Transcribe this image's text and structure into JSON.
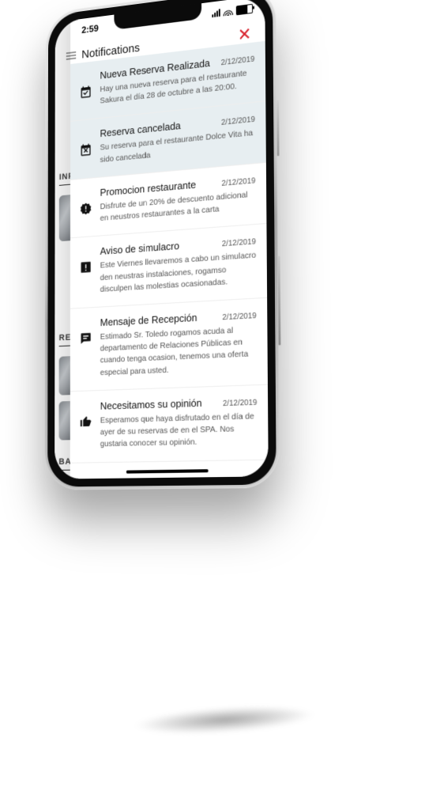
{
  "status": {
    "time": "2:59"
  },
  "header": {
    "title": "Notifications",
    "close_glyph": "✕"
  },
  "bg": {
    "label1": "INF",
    "label2": "RES",
    "label3": "BA"
  },
  "notifications": [
    {
      "unread": true,
      "icon": "calendar-check",
      "title": "Nueva Reserva Realizada",
      "date": "2/12/2019",
      "body": "Hay una nueva reserva para el restaurante Sakura el día 28 de octubre a las 20:00."
    },
    {
      "unread": true,
      "icon": "calendar-x",
      "title": "Reserva cancelada",
      "date": "2/12/2019",
      "body": "Su reserva para el restaurante Dolce Vita ha sido cancelada"
    },
    {
      "unread": false,
      "icon": "badge-alert",
      "title": "Promocion restaurante",
      "date": "2/12/2019",
      "body": "Disfrute de un 20% de descuento adicional en neustros restaurantes a la carta"
    },
    {
      "unread": false,
      "icon": "alert-box",
      "title": "Aviso de simulacro",
      "date": "2/12/2019",
      "body": "Este Viernes llevaremos a cabo un simulacro den neustras instalaciones, rogamso disculpen las molestias ocasionadas."
    },
    {
      "unread": false,
      "icon": "chat",
      "title": "Mensaje de Recepción",
      "date": "2/12/2019",
      "body": "Estimado Sr. Toledo rogamos acuda al departamento de Relaciones Públicas en cuando tenga ocasion, tenemos una oferta especial para usted."
    },
    {
      "unread": false,
      "icon": "thumb-up",
      "title": "Necesitamos su opinión",
      "date": "2/12/2019",
      "body": "Esperamos que haya disfrutado en el día de ayer de su reservas de en el SPA. Nos gustaria conocer su opinión."
    }
  ]
}
